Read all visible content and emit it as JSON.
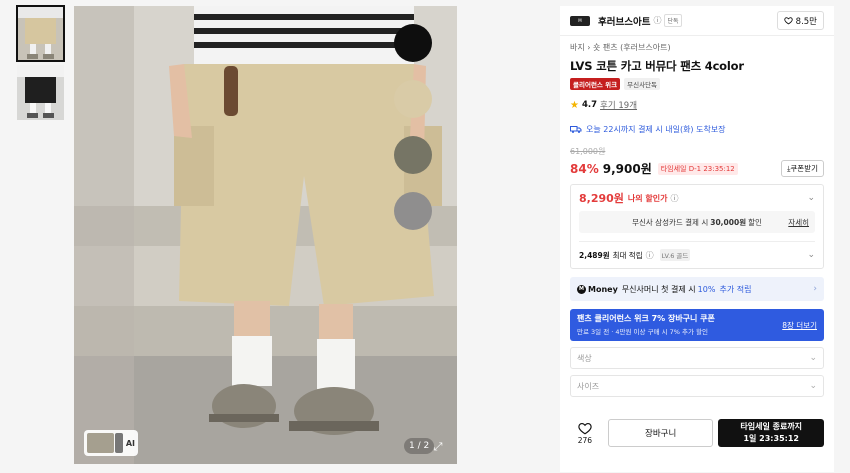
{
  "gallery": {
    "counter": "1 / 2",
    "ai_label": "AI",
    "swatch_colors": [
      "#0e0e0e",
      "#d9cba7",
      "#767565",
      "#8f8e8e"
    ]
  },
  "brand": {
    "name": "후러브스아트",
    "badge": "단독",
    "likes": "8.5만"
  },
  "product": {
    "breadcrumb": "바지 › 숏 팬츠 (후러브스아트)",
    "title": "LVS 코튼 카고 버뮤다 팬츠 4color",
    "tag1": "클리어런스 위크",
    "tag2": "무신사단독",
    "rating": "4.7",
    "reviews": "후기 19개",
    "shipping": "오늘 22시까지 결제 시 내일(화) 도착보장",
    "original_price": "61,000원",
    "discount": "84%",
    "price": "9,900원",
    "timesale": "타임세일 D-1 23:35:12",
    "coupon_button": "쿠폰받기"
  },
  "benefits": {
    "my_price": "8,290원",
    "my_price_label": "나의 할인가",
    "card_text_pre": "무신사 삼성카드 결제 시",
    "card_text_amount": "30,000원",
    "card_text_post": "할인",
    "card_detail": "자세히",
    "points_amount": "2,489원",
    "points_label": "최대 적립",
    "level": "LV.6 골드"
  },
  "money": {
    "logo": "Money",
    "text_pre": "무신사머니 첫 결제 시",
    "text_highlight": "10%",
    "text_post": "추가 적립"
  },
  "coupon_banner": {
    "line1": "팬츠 클리어런스 위크 7% 장바구니 쿠폰",
    "line2": "만료 3일 전 · 4만원 이상 구매 시 7% 추가 할인",
    "more": "8장 더보기"
  },
  "options": {
    "color_placeholder": "색상",
    "size_placeholder": "사이즈"
  },
  "actions": {
    "wish_count": "276",
    "cart": "장바구니",
    "buy_line1": "타임세일 종료까지",
    "buy_line2": "1일 23:35:12"
  }
}
